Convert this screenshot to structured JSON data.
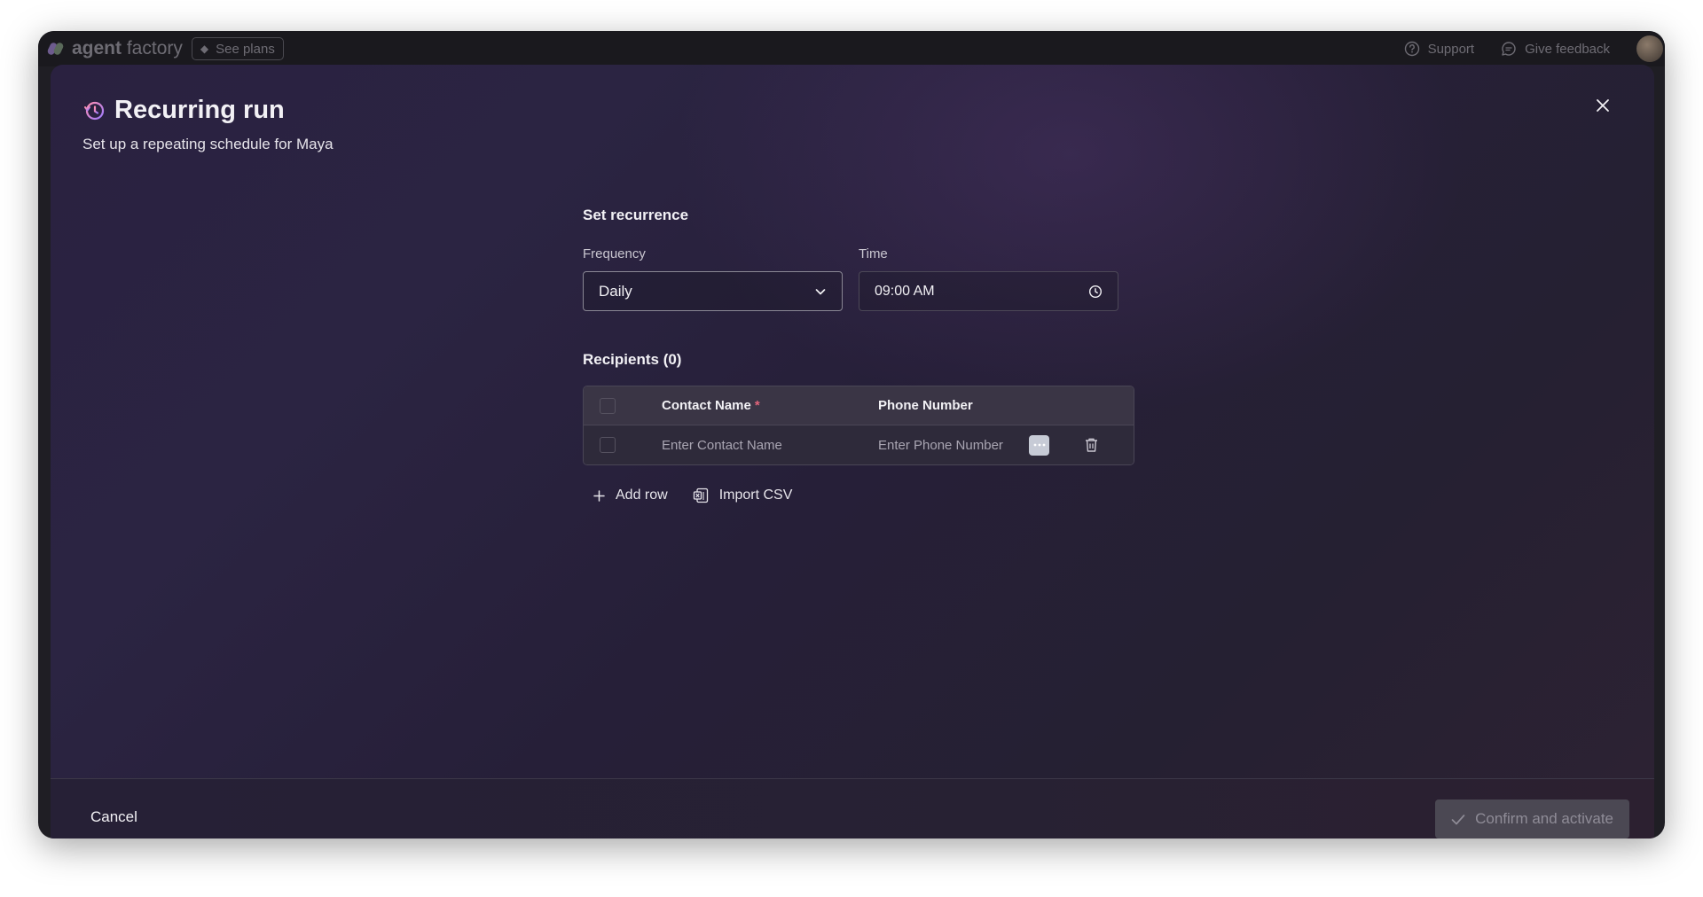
{
  "app": {
    "brand_bold": "agent",
    "brand_light": " factory",
    "see_plans": "See plans",
    "support": "Support",
    "give_feedback": "Give feedback"
  },
  "modal": {
    "title": "Recurring run",
    "subtitle": "Set up a repeating schedule for Maya",
    "recurrence": {
      "section_title": "Set recurrence",
      "frequency_label": "Frequency",
      "frequency_value": "Daily",
      "time_label": "Time",
      "time_value": "09:00 AM"
    },
    "recipients": {
      "section_title": "Recipients (0)",
      "columns": {
        "contact_name": "Contact Name",
        "required_mark": "*",
        "phone_number": "Phone Number"
      },
      "row": {
        "contact_placeholder": "Enter Contact Name",
        "phone_placeholder": "Enter Phone Number"
      },
      "add_row": "Add row",
      "import_csv": "Import CSV"
    },
    "footer": {
      "cancel": "Cancel",
      "confirm": "Confirm and activate"
    }
  }
}
